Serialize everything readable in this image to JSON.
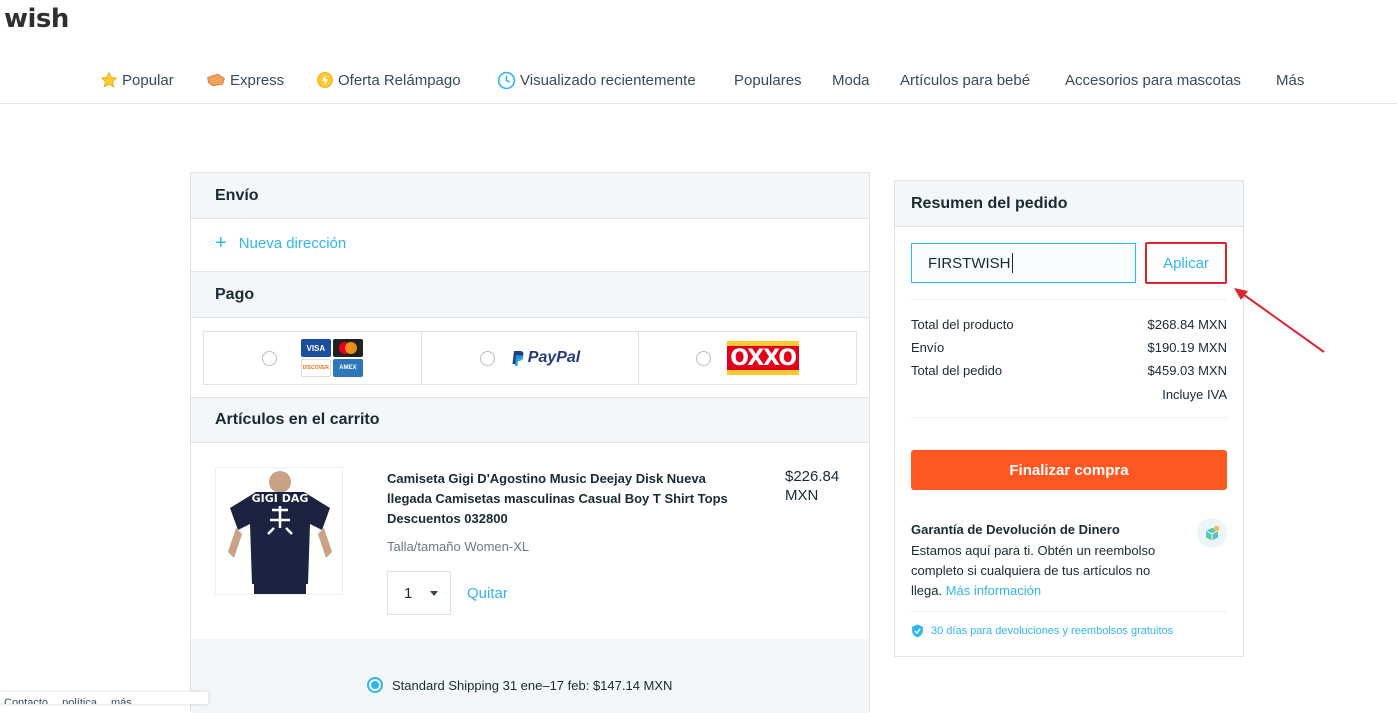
{
  "brand": {
    "logo_text": "wish"
  },
  "nav": {
    "items": [
      {
        "label": "Popular",
        "icon": "star-icon"
      },
      {
        "label": "Express",
        "icon": "express-icon"
      },
      {
        "label": "Oferta Relámpago",
        "icon": "lightning-deal-icon"
      },
      {
        "label": "Visualizado recientemente",
        "icon": "clock-icon"
      },
      {
        "label": "Populares"
      },
      {
        "label": "Moda"
      },
      {
        "label": "Artículos para bebé"
      },
      {
        "label": "Accesorios para mascotas"
      },
      {
        "label": "Más"
      }
    ]
  },
  "shipping": {
    "heading": "Envío",
    "new_address": "Nueva dirección"
  },
  "payment": {
    "heading": "Pago",
    "card_logos": [
      "VISA",
      "DISCOVER",
      "AMEX"
    ],
    "paypal_label": "PayPal",
    "oxxo_label": "OXXO"
  },
  "cart": {
    "heading": "Artículos en el carrito",
    "item": {
      "title": "Camiseta Gigi D'Agostino Music Deejay Disk Nueva llegada Camisetas masculinas Casual Boy T Shirt Tops Descuentos 032800",
      "size": "Talla/tamaño Women-XL",
      "price": "$226.84 MXN",
      "quantity": "1",
      "remove_label": "Quitar",
      "shirt_text": "GIGI DAG"
    },
    "shipping_option": "Standard Shipping 31 ene–17 feb: $147.14 MXN"
  },
  "summary": {
    "heading": "Resumen del pedido",
    "coupon_value": "FIRSTWISH",
    "apply_label": "Aplicar",
    "rows": [
      {
        "label": "Total del producto",
        "value": "$268.84 MXN"
      },
      {
        "label": "Envío",
        "value": "$190.19 MXN"
      },
      {
        "label": "Total del pedido",
        "value": "$459.03 MXN"
      }
    ],
    "tax_note": "Incluye IVA",
    "checkout_label": "Finalizar compra",
    "guarantee_title": "Garantía de Devolución de Dinero",
    "guarantee_text": "Estamos aquí para ti. Obtén un reembolso completo si cualquiera de tus artículos no llega.",
    "guarantee_link": "Más información",
    "returns_text": "30 días para devoluciones y reembolsos gratuitos"
  },
  "cookie_bar": {
    "text": "Contacto… política… más"
  },
  "colors": {
    "accent": "#2fb7ec",
    "checkout": "#ff5722",
    "highlight": "#e0242f",
    "section_bg": "#f3f7f9"
  }
}
